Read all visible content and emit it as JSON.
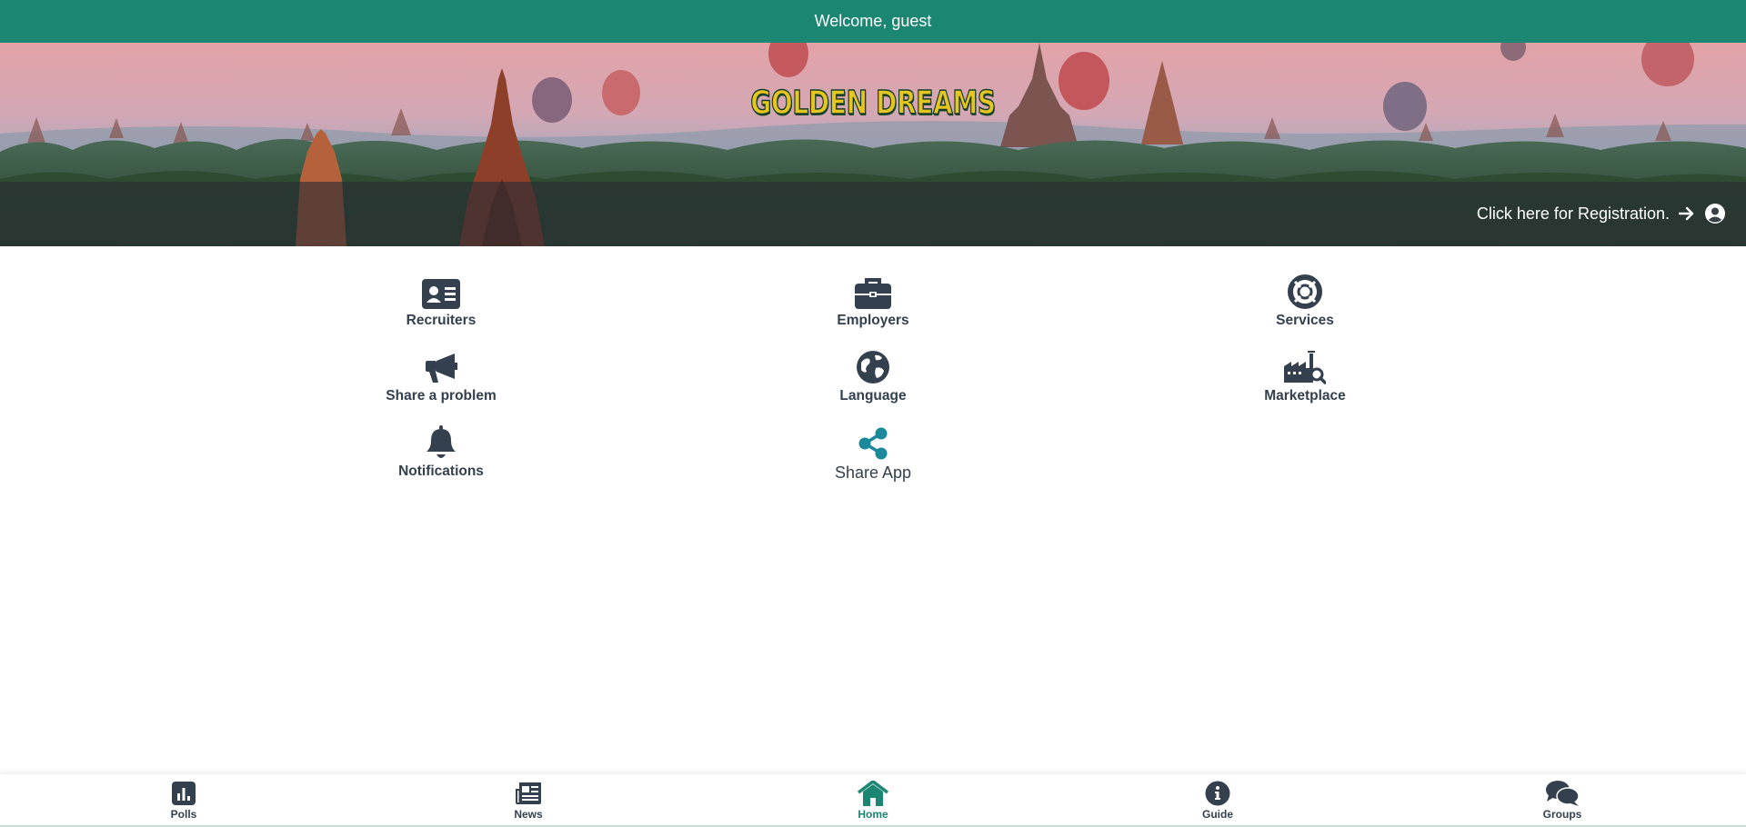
{
  "header": {
    "welcome": "Welcome, guest"
  },
  "banner": {
    "logo_text": "GOLDEN DREAMS",
    "registration_label": "Click here for Registration."
  },
  "tiles": [
    {
      "label": "Recruiters",
      "icon": "id-card-icon"
    },
    {
      "label": "Employers",
      "icon": "briefcase-icon"
    },
    {
      "label": "Services",
      "icon": "life-ring-icon"
    },
    {
      "label": "Share a problem",
      "icon": "megaphone-icon"
    },
    {
      "label": "Language",
      "icon": "globe-icon"
    },
    {
      "label": "Marketplace",
      "icon": "factory-search-icon"
    },
    {
      "label": "Notifications",
      "icon": "bell-icon"
    },
    {
      "label": "Share App",
      "icon": "share-icon"
    }
  ],
  "bottom_nav": [
    {
      "label": "Polls",
      "icon": "poll-icon",
      "active": false
    },
    {
      "label": "News",
      "icon": "newspaper-icon",
      "active": false
    },
    {
      "label": "Home",
      "icon": "home-icon",
      "active": true
    },
    {
      "label": "Guide",
      "icon": "info-icon",
      "active": false
    },
    {
      "label": "Groups",
      "icon": "comments-icon",
      "active": false
    }
  ],
  "colors": {
    "primary": "#1b8672",
    "icon": "#34404e",
    "share_icon": "#1a8a9a",
    "logo": "#e5c51f"
  }
}
